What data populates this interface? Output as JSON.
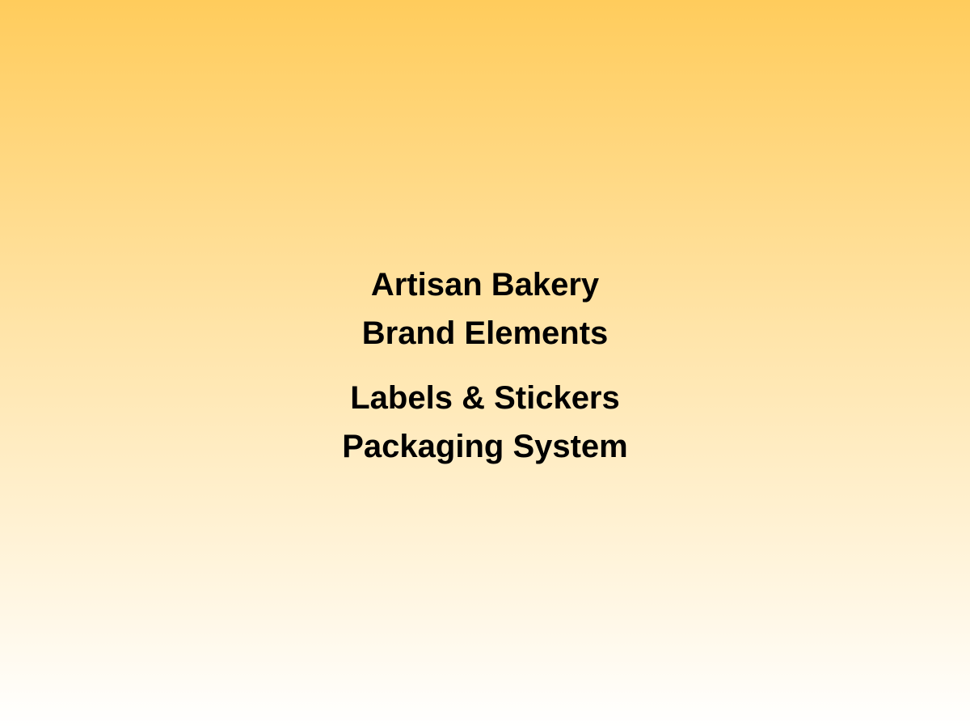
{
  "title": {
    "line1": "Artisan Bakery",
    "line2": "Brand Elements",
    "line3": "Labels & Stickers",
    "line4": "Packaging System"
  },
  "colors": {
    "gradient_top": "#FFCC5C",
    "gradient_bottom": "#FFFFFF",
    "text": "#000000"
  }
}
